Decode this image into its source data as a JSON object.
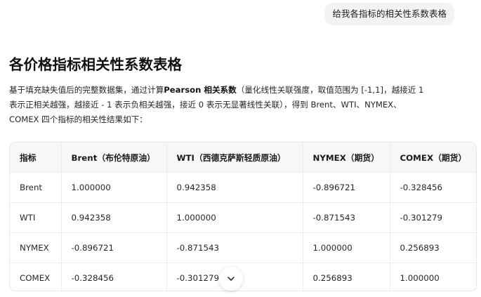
{
  "user_message": "给我各指标的相关性系数表格",
  "title": "各价格指标相关性系数表格",
  "intro": {
    "line1_a": "基于填充缺失值后的完整数据集，通过计算",
    "line1_bold": "Pearson 相关系数",
    "line1_b": "（量化线性关联强度，取值范围为 [-1,1]，越接近 1",
    "line2": "表示正相关越强，越接近 - 1 表示负相关越强，接近 0 表示无显著线性关联），得到 Brent、WTI、NYMEX、",
    "line3": "COMEX 四个指标的相关性结果如下："
  },
  "table": {
    "headers": [
      "指标",
      "Brent（布伦特原油）",
      "WTI（西德克萨斯轻质原油）",
      "NYMEX（期货）",
      "COMEX（期货）"
    ],
    "rows": [
      [
        "Brent",
        "1.000000",
        "0.942358",
        "-0.896721",
        "-0.328456"
      ],
      [
        "WTI",
        "0.942358",
        "1.000000",
        "-0.871543",
        "-0.301279"
      ],
      [
        "NYMEX",
        "-0.896721",
        "-0.871543",
        "1.000000",
        "0.256893"
      ],
      [
        "COMEX",
        "-0.328456",
        "-0.301279",
        "0.256893",
        "1.000000"
      ]
    ]
  },
  "scroll_button": {
    "icon": "chevron-down-icon"
  }
}
